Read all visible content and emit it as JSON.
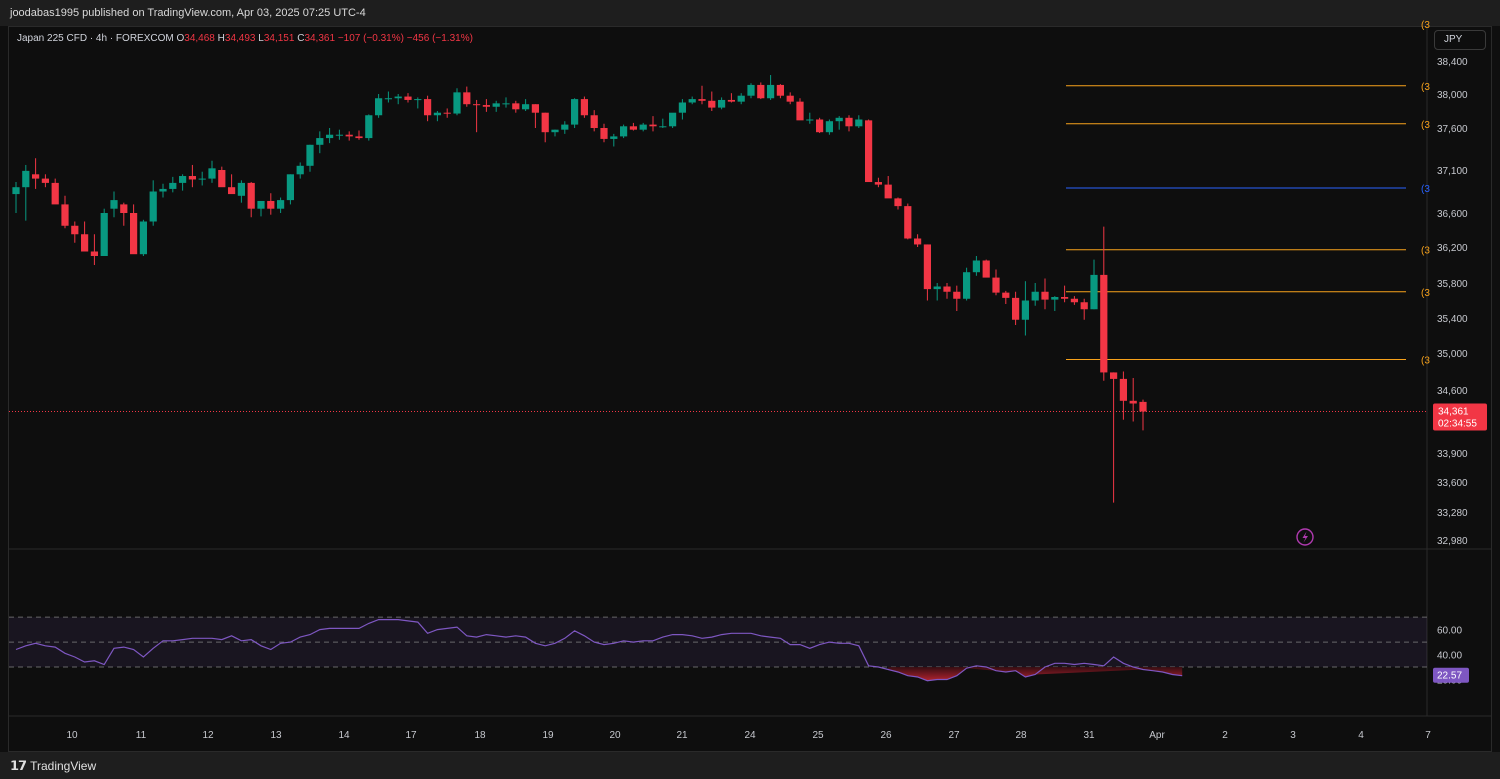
{
  "header": {
    "published": "joodabas1995 published on TradingView.com, Apr 03, 2025 07:25 UTC-4"
  },
  "legend": {
    "symbol": "Japan 225 CFD · 4h · FOREXCOM",
    "o_label": "O",
    "o": "34,468",
    "h_label": "H",
    "h": "34,493",
    "l_label": "L",
    "l": "34,151",
    "c_label": "C",
    "c": "34,361",
    "change": "−107 (−0.31%)",
    "change2": "−456 (−1.31%)"
  },
  "currency_button": "JPY",
  "price_badge": {
    "price": "34,361",
    "countdown": "02:34:55"
  },
  "rsi_badge": "22.57",
  "footer": {
    "brand": "TradingView"
  },
  "colors": {
    "up": "#089981",
    "down": "#f23645",
    "orange_level": "#f7a21b",
    "blue_level": "#2962ff",
    "rsi_line": "#7e57c2"
  },
  "chart_data": [
    {
      "type": "candlestick",
      "title": "Japan 225 CFD · 4h · FOREXCOM",
      "price_axis_ticks": [
        "38,400",
        "38,000",
        "37,600",
        "37,100",
        "36,600",
        "36,200",
        "35,800",
        "35,400",
        "35,000",
        "34,600",
        "33,900",
        "33,600",
        "33,280",
        "32,980"
      ],
      "x_ticks": [
        "10",
        "11",
        "12",
        "13",
        "14",
        "17",
        "18",
        "19",
        "20",
        "21",
        "24",
        "25",
        "26",
        "27",
        "28",
        "31",
        "Apr",
        "2",
        "3",
        "4",
        "7"
      ],
      "ylim": [
        32980,
        38400
      ],
      "last_price": 34361,
      "horizontal_levels": [
        {
          "price": 38100,
          "color": "orange"
        },
        {
          "price": 37650,
          "color": "orange"
        },
        {
          "price": 36890,
          "color": "blue"
        },
        {
          "price": 36170,
          "color": "orange"
        },
        {
          "price": 35700,
          "color": "orange"
        },
        {
          "price": 34930,
          "color": "orange"
        }
      ],
      "level_label": "(3",
      "candles": [
        [
          36820,
          36960,
          36600,
          36900
        ],
        [
          36900,
          37160,
          36510,
          37090
        ],
        [
          37050,
          37240,
          36880,
          37000
        ],
        [
          37000,
          37050,
          36900,
          36950
        ],
        [
          36950,
          37000,
          36720,
          36700
        ],
        [
          36700,
          36800,
          36420,
          36450
        ],
        [
          36450,
          36500,
          36250,
          36350
        ],
        [
          36350,
          36500,
          36150,
          36150
        ],
        [
          36150,
          36350,
          36000,
          36100
        ],
        [
          36100,
          36650,
          36100,
          36600
        ],
        [
          36650,
          36850,
          36550,
          36750
        ],
        [
          36700,
          36720,
          36450,
          36600
        ],
        [
          36600,
          36700,
          36180,
          36120
        ],
        [
          36120,
          36520,
          36100,
          36500
        ],
        [
          36500,
          36980,
          36450,
          36850
        ],
        [
          36850,
          36940,
          36780,
          36880
        ],
        [
          36880,
          37020,
          36840,
          36950
        ],
        [
          36950,
          37050,
          36860,
          37030
        ],
        [
          37030,
          37160,
          36900,
          36990
        ],
        [
          36990,
          37080,
          36920,
          37000
        ],
        [
          37000,
          37210,
          36950,
          37120
        ],
        [
          37100,
          37140,
          36980,
          36900
        ],
        [
          36900,
          37050,
          36840,
          36820
        ],
        [
          36800,
          36980,
          36720,
          36950
        ],
        [
          36950,
          36960,
          36550,
          36650
        ],
        [
          36650,
          36740,
          36560,
          36740
        ],
        [
          36740,
          36830,
          36580,
          36650
        ],
        [
          36650,
          36780,
          36600,
          36750
        ],
        [
          36750,
          37050,
          36700,
          37050
        ],
        [
          37050,
          37190,
          37000,
          37150
        ],
        [
          37150,
          37400,
          37080,
          37400
        ],
        [
          37400,
          37560,
          37300,
          37480
        ],
        [
          37480,
          37600,
          37420,
          37520
        ],
        [
          37520,
          37580,
          37460,
          37520
        ],
        [
          37520,
          37560,
          37450,
          37500
        ],
        [
          37500,
          37570,
          37460,
          37480
        ],
        [
          37480,
          37760,
          37450,
          37750
        ],
        [
          37750,
          38000,
          37720,
          37950
        ],
        [
          37950,
          38030,
          37900,
          37950
        ],
        [
          37950,
          38000,
          37880,
          37970
        ],
        [
          37970,
          38010,
          37900,
          37930
        ],
        [
          37930,
          37960,
          37830,
          37940
        ],
        [
          37940,
          37980,
          37680,
          37750
        ],
        [
          37750,
          37800,
          37680,
          37780
        ],
        [
          37780,
          37830,
          37720,
          37770
        ],
        [
          37770,
          38070,
          37750,
          38020
        ],
        [
          38020,
          38090,
          37850,
          37880
        ],
        [
          37880,
          37930,
          37550,
          37870
        ],
        [
          37870,
          37940,
          37790,
          37850
        ],
        [
          37850,
          37920,
          37790,
          37890
        ],
        [
          37890,
          37960,
          37840,
          37890
        ],
        [
          37890,
          37920,
          37780,
          37820
        ],
        [
          37820,
          37940,
          37800,
          37880
        ],
        [
          37880,
          37880,
          37600,
          37780
        ],
        [
          37780,
          37780,
          37430,
          37550
        ],
        [
          37550,
          37580,
          37500,
          37580
        ],
        [
          37580,
          37680,
          37530,
          37640
        ],
        [
          37640,
          37950,
          37600,
          37940
        ],
        [
          37940,
          37970,
          37720,
          37750
        ],
        [
          37750,
          37810,
          37560,
          37600
        ],
        [
          37600,
          37650,
          37430,
          37470
        ],
        [
          37470,
          37530,
          37380,
          37500
        ],
        [
          37500,
          37640,
          37480,
          37620
        ],
        [
          37620,
          37660,
          37570,
          37580
        ],
        [
          37580,
          37660,
          37560,
          37640
        ],
        [
          37640,
          37740,
          37560,
          37620
        ],
        [
          37620,
          37710,
          37600,
          37620
        ],
        [
          37620,
          37760,
          37600,
          37780
        ],
        [
          37780,
          37940,
          37700,
          37900
        ],
        [
          37900,
          37970,
          37880,
          37940
        ],
        [
          37940,
          38100,
          37880,
          37920
        ],
        [
          37920,
          38030,
          37800,
          37840
        ],
        [
          37840,
          37960,
          37820,
          37930
        ],
        [
          37930,
          38010,
          37900,
          37910
        ],
        [
          37910,
          38010,
          37880,
          37980
        ],
        [
          37980,
          38130,
          37950,
          38110
        ],
        [
          38110,
          38140,
          37940,
          37950
        ],
        [
          37950,
          38230,
          37930,
          38110
        ],
        [
          38110,
          38120,
          37950,
          37980
        ],
        [
          37980,
          38020,
          37880,
          37910
        ],
        [
          37910,
          37950,
          37700,
          37690
        ],
        [
          37690,
          37780,
          37650,
          37700
        ],
        [
          37700,
          37720,
          37540,
          37550
        ],
        [
          37550,
          37700,
          37520,
          37680
        ],
        [
          37680,
          37740,
          37580,
          37720
        ],
        [
          37720,
          37750,
          37560,
          37620
        ],
        [
          37620,
          37750,
          37600,
          37700
        ],
        [
          37690,
          37700,
          37400,
          36960
        ],
        [
          36960,
          37010,
          36900,
          36930
        ],
        [
          36930,
          37030,
          36780,
          36770
        ],
        [
          36770,
          36780,
          36640,
          36680
        ],
        [
          36680,
          36710,
          36290,
          36300
        ],
        [
          36300,
          36350,
          36200,
          36230
        ],
        [
          36230,
          36230,
          35600,
          35730
        ],
        [
          35730,
          35800,
          35600,
          35760
        ],
        [
          35760,
          35800,
          35620,
          35700
        ],
        [
          35700,
          35770,
          35480,
          35620
        ],
        [
          35620,
          35970,
          35600,
          35920
        ],
        [
          35920,
          36100,
          35880,
          36050
        ],
        [
          36050,
          36060,
          35880,
          35860
        ],
        [
          35860,
          35950,
          35660,
          35690
        ],
        [
          35690,
          35710,
          35560,
          35630
        ],
        [
          35630,
          35700,
          35320,
          35380
        ],
        [
          35380,
          35820,
          35200,
          35600
        ],
        [
          35600,
          35800,
          35540,
          35700
        ],
        [
          35700,
          35850,
          35500,
          35610
        ],
        [
          35610,
          35650,
          35480,
          35640
        ],
        [
          35640,
          35770,
          35580,
          35620
        ],
        [
          35620,
          35650,
          35550,
          35580
        ],
        [
          35580,
          35620,
          35380,
          35500
        ],
        [
          35500,
          36060,
          35500,
          35890
        ],
        [
          35890,
          36440,
          34700,
          34790
        ],
        [
          34790,
          34790,
          33380,
          34720
        ],
        [
          34720,
          34800,
          34270,
          34480
        ],
        [
          34480,
          34730,
          34250,
          34450
        ],
        [
          34468,
          34493,
          34151,
          34361
        ]
      ]
    },
    {
      "type": "line",
      "title": "RSI",
      "y_ticks": [
        "60.00",
        "40.00",
        "20.00"
      ],
      "guide_levels": [
        70,
        50,
        30
      ],
      "last_value": 22.57,
      "values": [
        44,
        47,
        49,
        47,
        46,
        41,
        38,
        34,
        35,
        32,
        45,
        46,
        44,
        38,
        45,
        51,
        51,
        52,
        53,
        53,
        53,
        52,
        55,
        51,
        52,
        47,
        44,
        49,
        50,
        54,
        56,
        60,
        61,
        61,
        61,
        61,
        65,
        68,
        68,
        68,
        67,
        66,
        57,
        60,
        61,
        62,
        55,
        54,
        56,
        55,
        54,
        55,
        54,
        49,
        47,
        49,
        53,
        59,
        55,
        50,
        48,
        49,
        51,
        50,
        51,
        51,
        54,
        56,
        56,
        55,
        53,
        54,
        56,
        57,
        57,
        57,
        55,
        54,
        53,
        48,
        48,
        45,
        48,
        50,
        49,
        49,
        47,
        31,
        30,
        28,
        26,
        23,
        22,
        19,
        20,
        20,
        23,
        29,
        31,
        30,
        27,
        26,
        27,
        22,
        24,
        30,
        33,
        33,
        32,
        33,
        32,
        31,
        38,
        33,
        30,
        28,
        27,
        26,
        24,
        23
      ]
    }
  ]
}
